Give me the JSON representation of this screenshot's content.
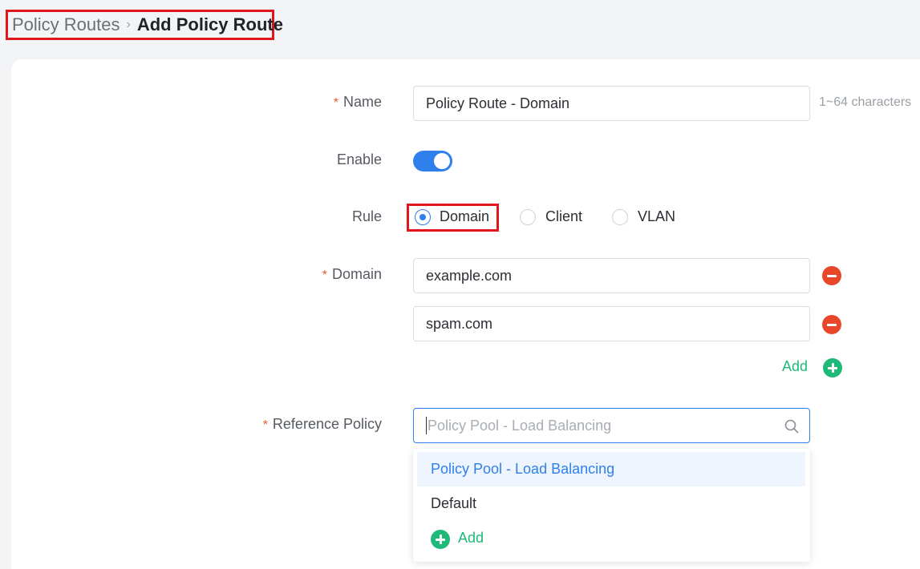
{
  "breadcrumb": {
    "parent": "Policy Routes",
    "separator": "›",
    "current": "Add Policy Route"
  },
  "form": {
    "name": {
      "required_mark": "*",
      "label": "Name",
      "value": "Policy Route - Domain",
      "hint": "1~64 characters"
    },
    "enable": {
      "label": "Enable",
      "checked": true
    },
    "rule": {
      "label": "Rule",
      "options": [
        {
          "label": "Domain",
          "checked": true
        },
        {
          "label": "Client",
          "checked": false
        },
        {
          "label": "VLAN",
          "checked": false
        }
      ]
    },
    "domain": {
      "required_mark": "*",
      "label": "Domain",
      "entries": [
        "example.com",
        "spam.com"
      ],
      "add_label": "Add"
    },
    "reference_policy": {
      "required_mark": "*",
      "label": "Reference Policy",
      "placeholder": "Policy Pool - Load Balancing",
      "dropdown": {
        "selected": "Policy Pool - Load Balancing",
        "options": [
          "Default"
        ],
        "add_label": "Add"
      }
    }
  },
  "colors": {
    "accent": "#2f80ed",
    "required": "#e85a2b",
    "add_green": "#1fb97a",
    "remove_red": "#e8472a",
    "highlight_border": "#e0161c"
  },
  "icons": {
    "remove": "minus-circle-icon",
    "add": "plus-circle-icon",
    "search": "search-icon",
    "separator": "chevron-right-icon"
  }
}
